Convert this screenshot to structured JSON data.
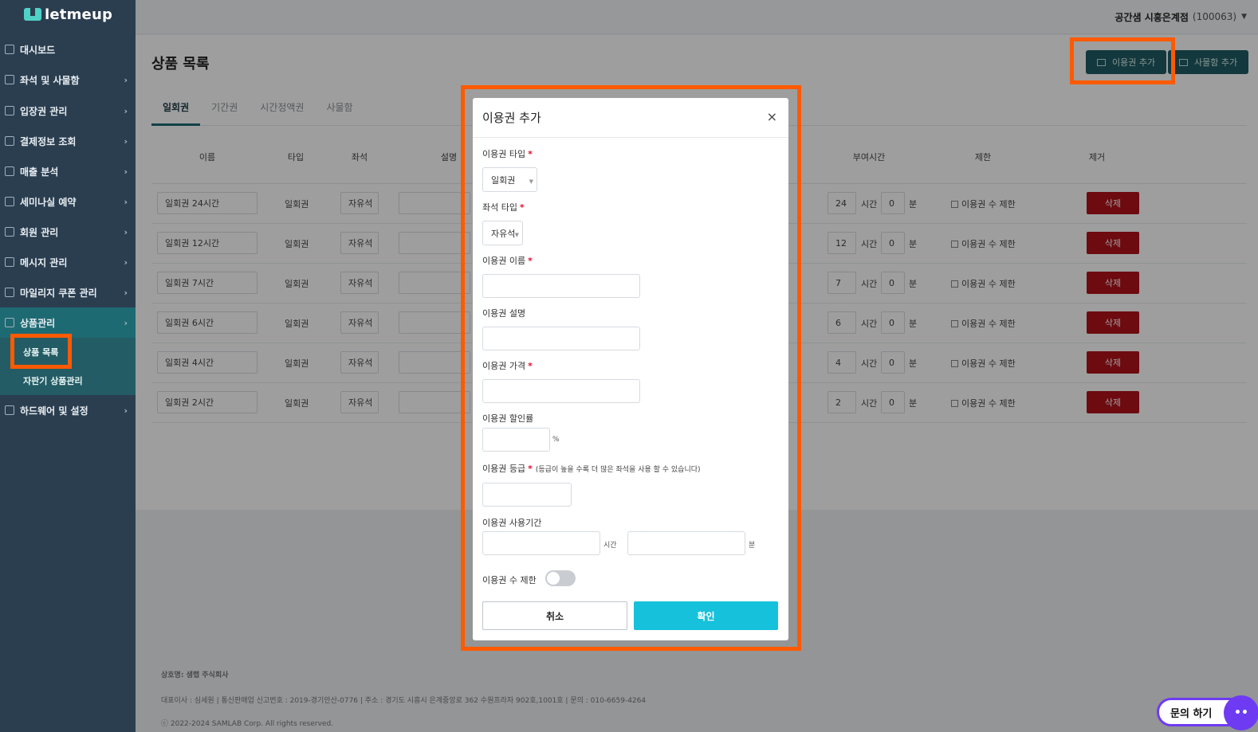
{
  "app": {
    "logo": "letmeup"
  },
  "topbar": {
    "store": "공간샘 시흥은계점",
    "code": "(100063)"
  },
  "sidebar": {
    "items": [
      {
        "label": "대시보드",
        "icon": "grid-icon",
        "chevron": ""
      },
      {
        "label": "좌석 및 사물함",
        "icon": "seat-icon",
        "chevron": "›"
      },
      {
        "label": "입장권 관리",
        "icon": "ticket-icon",
        "chevron": "›"
      },
      {
        "label": "결제정보 조회",
        "icon": "card-icon",
        "chevron": "›"
      },
      {
        "label": "매출 분석",
        "icon": "chart-icon",
        "chevron": "›"
      },
      {
        "label": "세미나실 예약",
        "icon": "calendar-icon",
        "chevron": "›"
      },
      {
        "label": "회원 관리",
        "icon": "users-icon",
        "chevron": "›"
      },
      {
        "label": "메시지 관리",
        "icon": "mail-icon",
        "chevron": "›"
      },
      {
        "label": "마일리지 쿠폰 관리",
        "icon": "coin-icon",
        "chevron": "›"
      },
      {
        "label": "상품관리",
        "icon": "product-icon",
        "chevron": "›"
      },
      {
        "label": "하드웨어 및 설정",
        "icon": "gear-icon",
        "chevron": "›"
      }
    ],
    "sub_items": [
      "상품 목록",
      "자판기 상품관리"
    ]
  },
  "main": {
    "title": "상품 목록",
    "add_ticket_button": "이용권 추가",
    "add_locker_button": "사물함 추가",
    "tabs": [
      "일회권",
      "기간권",
      "시간정액권",
      "사물함"
    ],
    "columns": [
      "이름",
      "타입",
      "좌석",
      "설명",
      "부여시간",
      "제한",
      "제거"
    ],
    "rows": [
      {
        "name": "일회권 24시간",
        "type": "일회권",
        "seat": "자유석",
        "hours": "24",
        "minutes": "0"
      },
      {
        "name": "일회권 12시간",
        "type": "일회권",
        "seat": "자유석",
        "hours": "12",
        "minutes": "0"
      },
      {
        "name": "일회권 7시간",
        "type": "일회권",
        "seat": "자유석",
        "hours": "7",
        "minutes": "0"
      },
      {
        "name": "일회권 6시간",
        "type": "일회권",
        "seat": "자유석",
        "hours": "6",
        "minutes": "0"
      },
      {
        "name": "일회권 4시간",
        "type": "일회권",
        "seat": "자유석",
        "hours": "4",
        "minutes": "0"
      },
      {
        "name": "일회권 2시간",
        "type": "일회권",
        "seat": "자유석",
        "hours": "2",
        "minutes": "0"
      }
    ],
    "hour_unit": "시간",
    "minute_unit": "분",
    "limit_label": "이용권 수 제한",
    "delete_label": "삭제"
  },
  "footer": {
    "company": "상호명: 샘랩 주식회사",
    "info": "대표이사 : 심세원 | 통신판매업 신고번호 : 2019-경기안산-0776 | 주소 : 경기도 시흥시 은계중앙로 362 수원프라자 902호,1001호 | 문의 : 010-6659-4264",
    "copyright": "ⓒ 2022-2024 SAMLAB Corp. All rights reserved."
  },
  "modal": {
    "title": "이용권 추가",
    "close": "×",
    "ticket_type_label": "이용권 타입",
    "ticket_type_value": "일회권",
    "seat_type_label": "좌석 타입",
    "seat_type_value": "자유석",
    "name_label": "이용권 이름",
    "desc_label": "이용권 설명",
    "price_label": "이용권 가격",
    "discount_label": "이용권 할인률",
    "discount_unit": "%",
    "grade_label": "이용권 등급",
    "grade_hint": "(등급이 높을 수록 더 많은 좌석을 사용 할 수 있습니다)",
    "period_label": "이용권 사용기간",
    "hour_unit": "시간",
    "minute_unit": "분",
    "limit_label": "이용권 수 제한",
    "limit_on": false,
    "cancel": "취소",
    "confirm": "확인",
    "required_mark": "*"
  },
  "chat": {
    "label": "문의 하기"
  },
  "colors": {
    "highlight": "#ff5a00",
    "confirm": "#16c1db",
    "delete": "#b0121a",
    "sidebar": "#2b3e50"
  }
}
